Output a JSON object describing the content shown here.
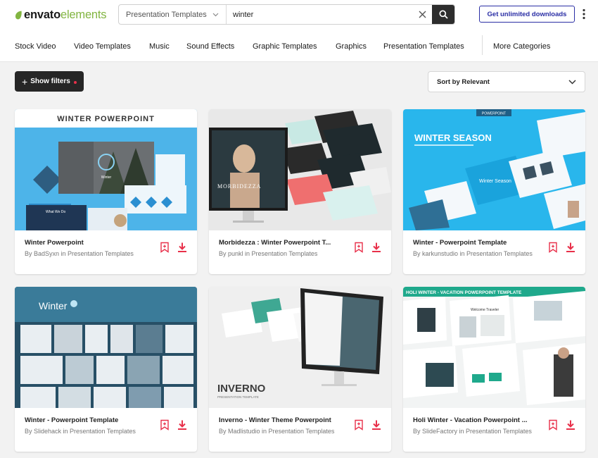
{
  "brand": {
    "name_bold": "envato",
    "name_light": "elements",
    "accent": "#82b541"
  },
  "search": {
    "category": "Presentation Templates",
    "query": "winter"
  },
  "header": {
    "cta_label": "Get unlimited downloads"
  },
  "categories": [
    "Stock Video",
    "Video Templates",
    "Music",
    "Sound Effects",
    "Graphic Templates",
    "Graphics",
    "Presentation Templates",
    "More Categories"
  ],
  "filters": {
    "label": "Show filters"
  },
  "sort": {
    "label": "Sort by Relevant"
  },
  "colors": {
    "action": "#e8304a",
    "cta": "#2a2ea5",
    "dark": "#262626"
  },
  "thumb_text": {
    "t1_heading": "WINTER POWERPOINT",
    "t1_slide": "Winter",
    "t1_section": "What We Do",
    "t2_brand": "MORBIDEZZA",
    "t3_tag": "POWERPOINT",
    "t3_heading": "WINTER SEASON",
    "t3_sub": "Winter Season",
    "t4_heading": "Winter",
    "t5_heading": "INVERNO",
    "t5_sub": "PRESENTATION TEMPLATE",
    "t6_heading": "HOLI WINTER - VACATION POWERPOINT TEMPLATE",
    "t6_slide": "Welcome Traveler"
  },
  "cards": [
    {
      "title": "Winter Powerpoint",
      "by": "By BadSyxn in Presentation Templates"
    },
    {
      "title": "Morbidezza : Winter Powerpoint T...",
      "by": "By punkl in Presentation Templates"
    },
    {
      "title": "Winter - Powerpoint Template",
      "by": "By karkunstudio in Presentation Templates"
    },
    {
      "title": "Winter - Powerpoint Template",
      "by": "By Slidehack in Presentation Templates"
    },
    {
      "title": "Inverno - Winter Theme Powerpoint",
      "by": "By Madlistudio in Presentation Templates"
    },
    {
      "title": "Holi Winter - Vacation Powerpoint ...",
      "by": "By SlideFactory in Presentation Templates"
    }
  ]
}
